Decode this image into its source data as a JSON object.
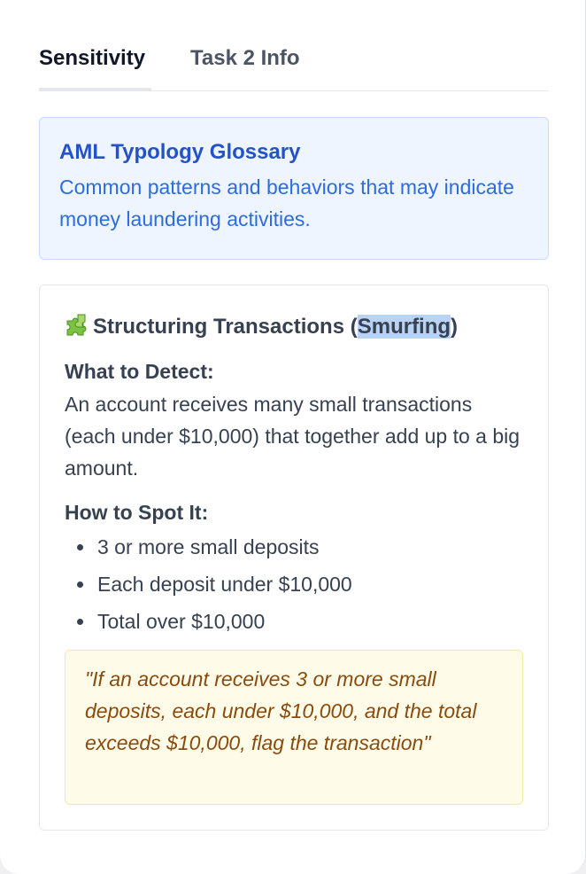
{
  "tabs": [
    {
      "label": "Sensitivity",
      "active": true
    },
    {
      "label": "Task 2 Info",
      "active": false
    }
  ],
  "glossary": {
    "title": "AML Typology Glossary",
    "description": "Common patterns and behaviors that may indicate money laundering activities."
  },
  "typology": {
    "icon": "puzzle-piece-icon",
    "title_before": "Structuring Transactions (",
    "title_highlight": "Smurfing",
    "title_after": ")",
    "detect_label": "What to Detect:",
    "detect_text": "An account receives many small transactions (each under $10,000) that together add up to a big amount.",
    "spot_label": "How to Spot It:",
    "spot_items": [
      "3 or more small deposits",
      "Each deposit under $10,000",
      "Total over $10,000"
    ],
    "rule_quote": "\"If an account receives 3 or more small deposits, each under $10,000, and the total exceeds $10,000, flag the transaction\""
  },
  "colors": {
    "glossary_bg": "#eef5ff",
    "glossary_title": "#2453c7",
    "quote_bg": "#fefce8",
    "quote_text": "#8a4b0f",
    "highlight": "#b9d3f4"
  }
}
